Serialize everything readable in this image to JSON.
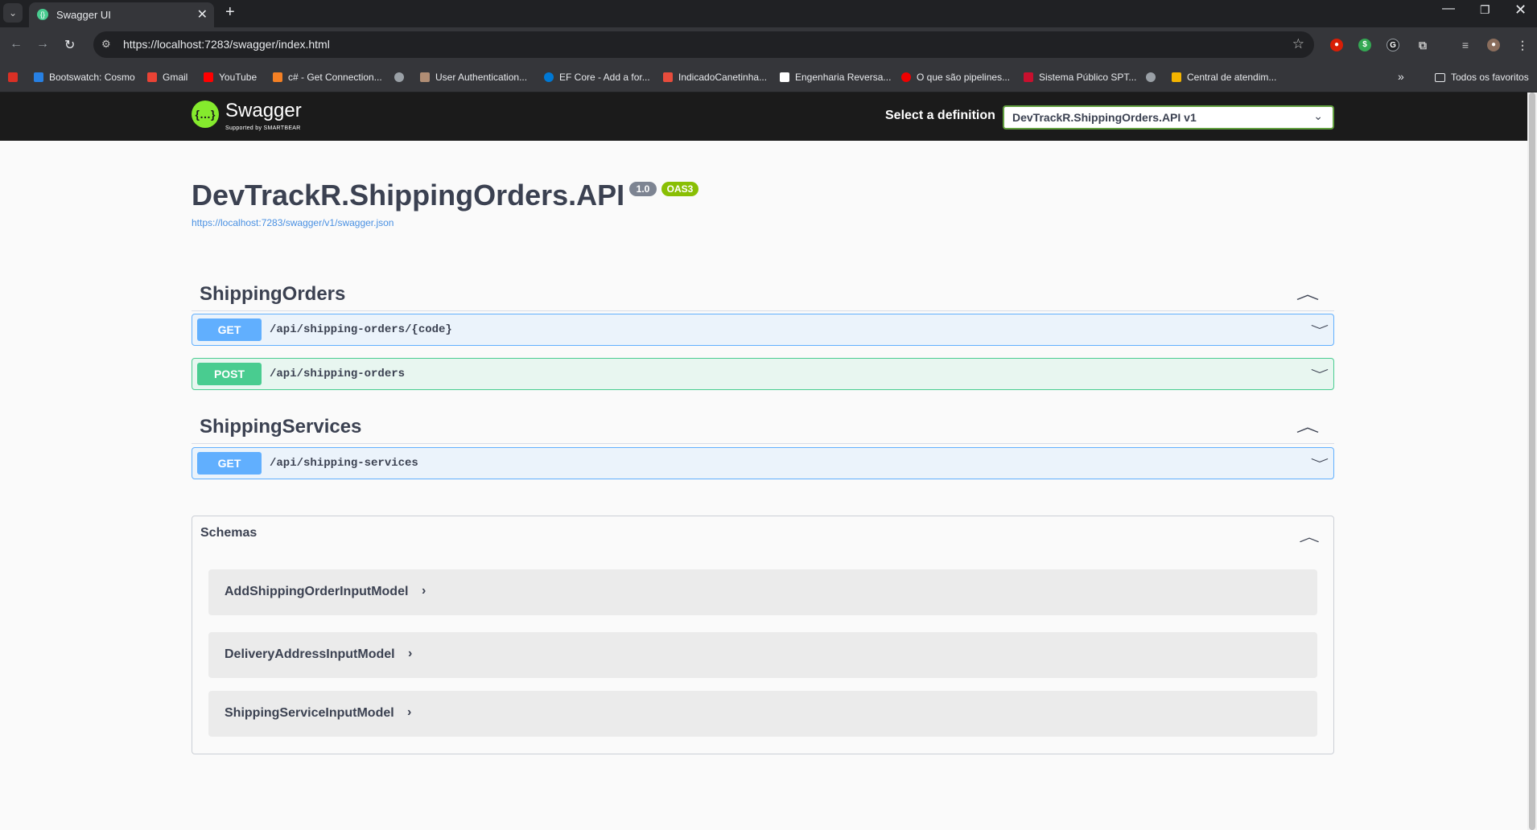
{
  "browser": {
    "tab_title": "Swagger UI",
    "url": "https://localhost:7283/swagger/index.html",
    "bookmarks": [
      "Bootswatch: Cosmo",
      "Gmail",
      "YouTube",
      "c# - Get Connection...",
      "User Authentication...",
      "EF Core - Add a for...",
      "IndicadoCanetinha...",
      "Engenharia Reversa...",
      "O que são pipelines...",
      "Sistema Público SPT...",
      "Central de atendim..."
    ],
    "all_bookmarks": "Todos os favoritos"
  },
  "swagger": {
    "logo_text": "Swagger",
    "logo_sub": "Supported by SMARTBEAR",
    "definition_label": "Select a definition",
    "definition_value": "DevTrackR.ShippingOrders.API v1"
  },
  "api": {
    "title": "DevTrackR.ShippingOrders.API",
    "version": "1.0",
    "oas": "OAS3",
    "spec_url": "https://localhost:7283/swagger/v1/swagger.json"
  },
  "sections": [
    {
      "name": "ShippingOrders",
      "operations": [
        {
          "method": "GET",
          "path": "/api/shipping-orders/{code}"
        },
        {
          "method": "POST",
          "path": "/api/shipping-orders"
        }
      ]
    },
    {
      "name": "ShippingServices",
      "operations": [
        {
          "method": "GET",
          "path": "/api/shipping-services"
        }
      ]
    }
  ],
  "schemas": {
    "title": "Schemas",
    "models": [
      "AddShippingOrderInputModel",
      "DeliveryAddressInputModel",
      "ShippingServiceInputModel"
    ]
  },
  "colors": {
    "get": "#61affe",
    "post": "#49cc90",
    "swagger_green": "#85ea2d",
    "topbar": "#1b1b1b"
  }
}
